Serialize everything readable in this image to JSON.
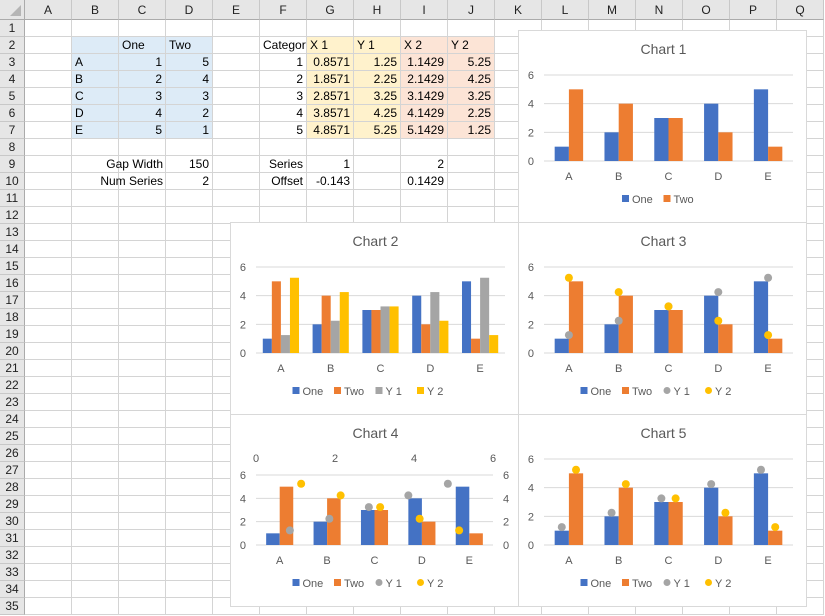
{
  "sheet": {
    "columns": [
      "A",
      "B",
      "C",
      "D",
      "E",
      "F",
      "G",
      "H",
      "I",
      "J",
      "K",
      "L",
      "M",
      "N",
      "O",
      "P",
      "Q"
    ],
    "rows": 35,
    "table1": {
      "headers": [
        "",
        "One",
        "Two"
      ],
      "rows": [
        [
          "A",
          "1",
          "5"
        ],
        [
          "B",
          "2",
          "4"
        ],
        [
          "C",
          "3",
          "3"
        ],
        [
          "D",
          "4",
          "2"
        ],
        [
          "E",
          "5",
          "1"
        ]
      ]
    },
    "table2": {
      "headers": [
        "Category",
        "X 1",
        "Y 1",
        "X 2",
        "Y 2"
      ],
      "rows": [
        [
          "1",
          "0.8571",
          "1.25",
          "1.1429",
          "5.25"
        ],
        [
          "2",
          "1.8571",
          "2.25",
          "2.1429",
          "4.25"
        ],
        [
          "3",
          "2.8571",
          "3.25",
          "3.1429",
          "3.25"
        ],
        [
          "4",
          "3.8571",
          "4.25",
          "4.1429",
          "2.25"
        ],
        [
          "5",
          "4.8571",
          "5.25",
          "5.1429",
          "1.25"
        ]
      ]
    },
    "params": {
      "gap_width_label": "Gap Width",
      "gap_width": "150",
      "num_series_label": "Num Series",
      "num_series": "2",
      "series_label": "Series",
      "series1": "1",
      "series2": "2",
      "offset_label": "Offset",
      "offset1": "-0.143",
      "offset2": "0.1429"
    }
  },
  "colors": {
    "one": "#4472c4",
    "two": "#ed7d31",
    "y1": "#a5a5a5",
    "y2": "#ffc000",
    "grid": "#d9d9d9"
  },
  "chart_data": [
    {
      "id": "chart1",
      "title": "Chart 1",
      "type": "bar",
      "categories": [
        "A",
        "B",
        "C",
        "D",
        "E"
      ],
      "series": [
        {
          "name": "One",
          "values": [
            1,
            2,
            3,
            4,
            5
          ],
          "kind": "bar"
        },
        {
          "name": "Two",
          "values": [
            5,
            4,
            3,
            2,
            1
          ],
          "kind": "bar"
        }
      ],
      "ylim": [
        0,
        6
      ],
      "yticks": [
        0,
        2,
        4,
        6
      ],
      "grid": true,
      "legend": "bottom"
    },
    {
      "id": "chart2",
      "title": "Chart 2",
      "type": "bar",
      "categories": [
        "A",
        "B",
        "C",
        "D",
        "E"
      ],
      "series": [
        {
          "name": "One",
          "values": [
            1,
            2,
            3,
            4,
            5
          ],
          "kind": "bar"
        },
        {
          "name": "Two",
          "values": [
            5,
            4,
            3,
            2,
            1
          ],
          "kind": "bar"
        },
        {
          "name": "Y 1",
          "values": [
            1.25,
            2.25,
            3.25,
            4.25,
            5.25
          ],
          "kind": "bar"
        },
        {
          "name": "Y 2",
          "values": [
            5.25,
            4.25,
            3.25,
            2.25,
            1.25
          ],
          "kind": "bar"
        }
      ],
      "ylim": [
        0,
        6
      ],
      "yticks": [
        0,
        2,
        4,
        6
      ],
      "grid": true,
      "legend": "bottom"
    },
    {
      "id": "chart3",
      "title": "Chart 3",
      "type": "bar",
      "categories": [
        "A",
        "B",
        "C",
        "D",
        "E"
      ],
      "series": [
        {
          "name": "One",
          "values": [
            1,
            2,
            3,
            4,
            5
          ],
          "kind": "bar"
        },
        {
          "name": "Two",
          "values": [
            5,
            4,
            3,
            2,
            1
          ],
          "kind": "bar"
        },
        {
          "name": "Y 1",
          "values": [
            1.25,
            2.25,
            3.25,
            4.25,
            5.25
          ],
          "kind": "marker-center"
        },
        {
          "name": "Y 2",
          "values": [
            5.25,
            4.25,
            3.25,
            2.25,
            1.25
          ],
          "kind": "marker-center"
        }
      ],
      "ylim": [
        0,
        6
      ],
      "yticks": [
        0,
        2,
        4,
        6
      ],
      "grid": true,
      "legend": "bottom"
    },
    {
      "id": "chart4",
      "title": "Chart 4",
      "type": "bar",
      "categories": [
        "A",
        "B",
        "C",
        "D",
        "E"
      ],
      "series": [
        {
          "name": "One",
          "values": [
            1,
            2,
            3,
            4,
            5
          ],
          "kind": "bar"
        },
        {
          "name": "Two",
          "values": [
            5,
            4,
            3,
            2,
            1
          ],
          "kind": "bar"
        },
        {
          "name": "Y 1",
          "x": [
            0.8571,
            1.8571,
            2.8571,
            3.8571,
            4.8571
          ],
          "values": [
            1.25,
            2.25,
            3.25,
            4.25,
            5.25
          ],
          "kind": "scatter-secondary"
        },
        {
          "name": "Y 2",
          "x": [
            1.1429,
            2.1429,
            3.1429,
            4.1429,
            5.1429
          ],
          "values": [
            5.25,
            4.25,
            3.25,
            2.25,
            1.25
          ],
          "kind": "scatter-secondary"
        }
      ],
      "ylim": [
        0,
        6
      ],
      "yticks": [
        0,
        2,
        4,
        6
      ],
      "secondary_xlim": [
        0,
        6
      ],
      "secondary_xticks": [
        0,
        2,
        4,
        6
      ],
      "secondary_ylim": [
        0,
        6
      ],
      "secondary_yticks": [
        0,
        2,
        4,
        6
      ],
      "grid": true,
      "legend": "bottom"
    },
    {
      "id": "chart5",
      "title": "Chart 5",
      "type": "bar",
      "categories": [
        "A",
        "B",
        "C",
        "D",
        "E"
      ],
      "series": [
        {
          "name": "One",
          "values": [
            1,
            2,
            3,
            4,
            5
          ],
          "kind": "bar"
        },
        {
          "name": "Two",
          "values": [
            5,
            4,
            3,
            2,
            1
          ],
          "kind": "bar"
        },
        {
          "name": "Y 1",
          "x": [
            0.8571,
            1.8571,
            2.8571,
            3.8571,
            4.8571
          ],
          "values": [
            1.25,
            2.25,
            3.25,
            4.25,
            5.25
          ],
          "kind": "scatter-aligned"
        },
        {
          "name": "Y 2",
          "x": [
            1.1429,
            2.1429,
            3.1429,
            4.1429,
            5.1429
          ],
          "values": [
            5.25,
            4.25,
            3.25,
            2.25,
            1.25
          ],
          "kind": "scatter-aligned"
        }
      ],
      "ylim": [
        0,
        6
      ],
      "yticks": [
        0,
        2,
        4,
        6
      ],
      "grid": true,
      "legend": "bottom"
    }
  ]
}
